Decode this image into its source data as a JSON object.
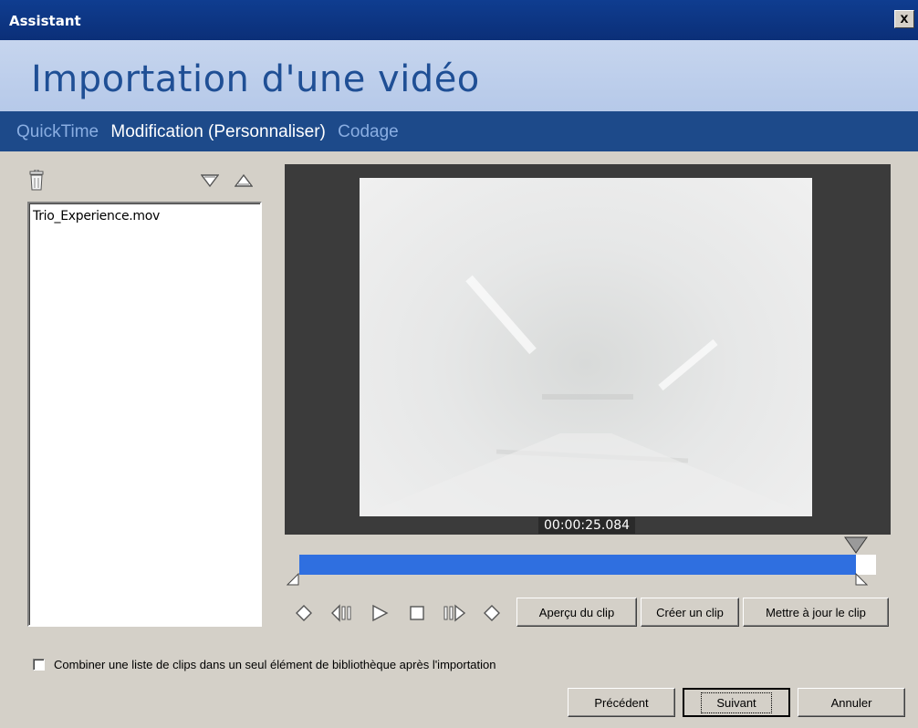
{
  "window": {
    "title": "Assistant",
    "close_label": "x"
  },
  "header": {
    "heading": "Importation d'une vidéo"
  },
  "steps": [
    {
      "label": "QuickTime",
      "active": false
    },
    {
      "label": "Modification (Personnaliser)",
      "active": true
    },
    {
      "label": "Codage",
      "active": false
    }
  ],
  "clip_list": {
    "toolbar_icons": [
      "trash-icon",
      "move-down-icon",
      "move-up-icon"
    ],
    "items": [
      "Trio_Experience.mov"
    ]
  },
  "preview": {
    "timecode": "00:00:25.084"
  },
  "timeline": {
    "colors": {
      "range": "#2f6fe0",
      "track": "#ffffff"
    },
    "selection_start": 0.0,
    "selection_end": 1.0,
    "playhead": 1.0
  },
  "transport": {
    "icons": [
      "go-to-start-icon",
      "step-back-icon",
      "play-icon",
      "stop-icon",
      "step-forward-icon",
      "go-to-end-icon"
    ],
    "preview_clip": "Aperçu du clip",
    "create_clip": "Créer un clip",
    "update_clip": "Mettre à jour le clip"
  },
  "options": {
    "combine_label": "Combiner une liste de clips dans un seul élément de bibliothèque après l'importation",
    "combine_checked": false
  },
  "footer": {
    "previous": "Précédent",
    "next": "Suivant",
    "cancel": "Annuler"
  }
}
